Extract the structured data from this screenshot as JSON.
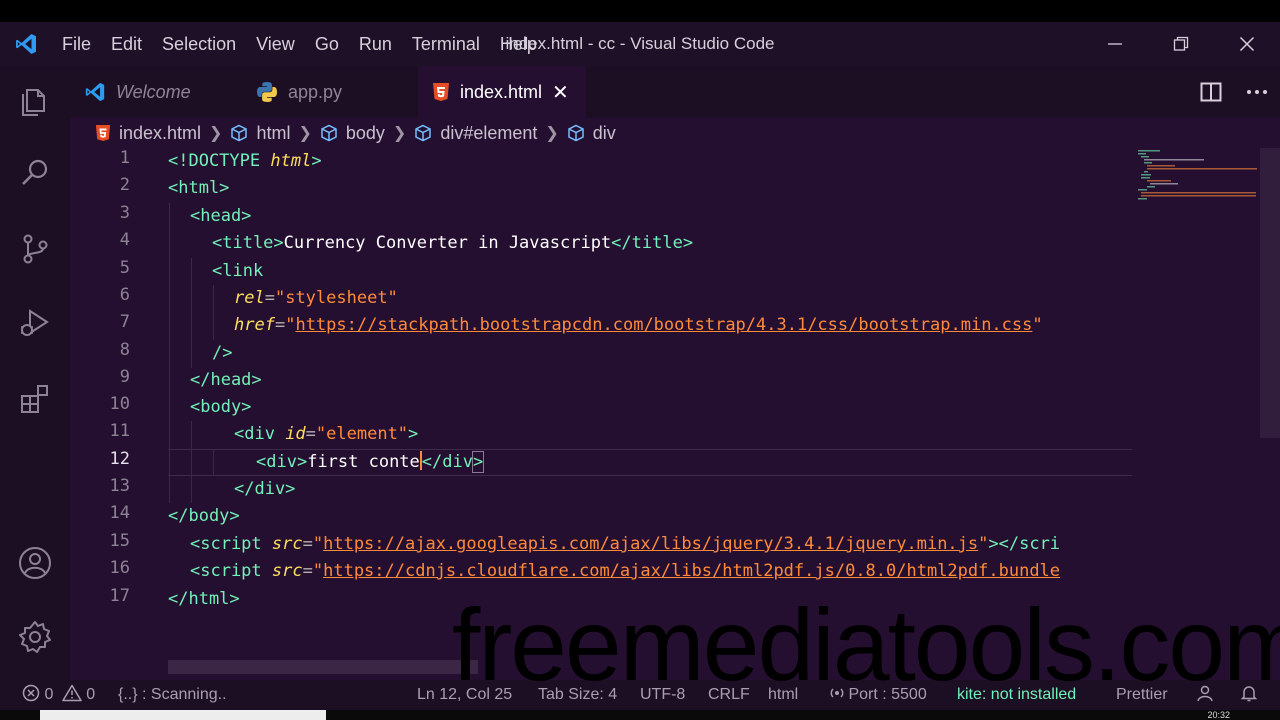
{
  "menu": [
    "File",
    "Edit",
    "Selection",
    "View",
    "Go",
    "Run",
    "Terminal",
    "Help"
  ],
  "window": {
    "title": "index.html - cc - Visual Studio Code"
  },
  "tabs": [
    {
      "label": "Welcome",
      "icon": "vscode-icon"
    },
    {
      "label": "app.py",
      "icon": "python-icon"
    },
    {
      "label": "index.html",
      "icon": "html5-icon",
      "close": "✕"
    }
  ],
  "breadcrumb": [
    "index.html",
    "html",
    "body",
    "div#element",
    "div"
  ],
  "line_numbers": [
    "1",
    "2",
    "3",
    "4",
    "5",
    "6",
    "7",
    "8",
    "9",
    "10",
    "11",
    "12",
    "13",
    "14",
    "15",
    "16",
    "17"
  ],
  "current_line": "12",
  "code": {
    "l1": {
      "open": "<!DOCTYPE ",
      "kw": "html",
      "close": ">"
    },
    "l2": "<html>",
    "l3": "<head>",
    "l4": {
      "open": "<title>",
      "text": "Currency Converter in Javascript",
      "close": "</title>"
    },
    "l5": "<link",
    "l6": {
      "attr": "rel",
      "eq": "=",
      "val": "\"stylesheet\""
    },
    "l7": {
      "attr": "href",
      "eq": "=",
      "q1": "\"",
      "url": "https://stackpath.bootstrapcdn.com/bootstrap/4.3.1/css/bootstrap.min.css",
      "q2": "\""
    },
    "l8": "/>",
    "l9": "</head>",
    "l10": "<body>",
    "l11": {
      "open": "<div ",
      "attr": "id",
      "eq": "=",
      "val": "\"element\"",
      "close": ">"
    },
    "l12": {
      "open": "<div>",
      "text": "first conte",
      "close_open": "</div",
      "close_end": ">"
    },
    "l13": "</div>",
    "l14": "</body>",
    "l15": {
      "open": "<script ",
      "attr": "src",
      "eq": "=",
      "q1": "\"",
      "url": "https://ajax.googleapis.com/ajax/libs/jquery/3.4.1/jquery.min.js",
      "q2": "\"",
      "close": "></scri"
    },
    "l16": {
      "open": "<script ",
      "attr": "src",
      "eq": "=",
      "q1": "\"",
      "url": "https://cdnjs.cloudflare.com/ajax/libs/html2pdf.js/0.8.0/html2pdf.bundle"
    },
    "l17": "</html>"
  },
  "status": {
    "errors": "0",
    "warnings": "0",
    "scanning": "{..} : Scanning..",
    "position": "Ln 12, Col 25",
    "tab_size": "Tab Size: 4",
    "encoding": "UTF-8",
    "eol": "CRLF",
    "language": "html",
    "port": "Port : 5500",
    "linter": "kite: not installed",
    "formatter": "Prettier"
  },
  "taskbar": {
    "time": "20:32"
  },
  "watermark": "freemediatools.com"
}
